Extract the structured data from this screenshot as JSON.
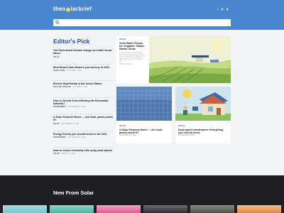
{
  "site": {
    "logo_parts": [
      "thes",
      "larbrief"
    ],
    "social_icons": [
      "facebook-icon",
      "twitter-icon",
      "twitter-bird-icon"
    ]
  },
  "search": {
    "placeholder": "",
    "value": ""
  },
  "editors_pick": {
    "title": "Editor's Pick",
    "items": [
      {
        "title": "Ten Facts about climate change you didn't know about",
        "category": "SOLAR",
        "date": ""
      },
      {
        "title": "Best Robot Lawn Mowers you can buy in 2020",
        "category": "SMART HOME",
        "date": "OCTOBER 2, 2020"
      },
      {
        "title": "Electric Boat Rental in the United States",
        "category": "ELECTRIC VEHICLES",
        "date": "OCTOBER 1, 2020"
      },
      {
        "title": "How is Corona Virus Affecting the Renewable Industry?",
        "category": "ENVIRONMENT",
        "date": "SEPTEMBER 30, 2020"
      },
      {
        "title": "A Solar-Powered Home — Are solar panels worth it?",
        "category": "SOLAR",
        "date": "SEPTEMBER 29, 2020"
      },
      {
        "title": "Energy Stocks you should invest in for 2021",
        "category": "ENVIRONMENT",
        "date": "SEPTEMBER 28, 2020"
      },
      {
        "title": "How to reduce electricity bills using solar panels",
        "category": "SOLAR",
        "date": "MARCH 12, 2020"
      }
    ]
  },
  "featured": {
    "category": "SOLAR",
    "title": "Solar Water Pumps for Irrigation: Simple Starter Guide",
    "excerpt": "This article is for those already farmed and looking to spend less on their irrigation bills. This list of solar water pumps for irrigation use...",
    "date": "MARCH 12, 2020"
  },
  "card_panels": {
    "category": "SOLAR",
    "title": "A Solar-Powered Home — Are solar panels worth it?",
    "date": "SEPTEMBER 29, 2020"
  },
  "card_maintenance": {
    "category": "SOLAR",
    "title": "Solar panel maintenance: Everything you need to know",
    "date": "SEPTEMBER 28, 2020"
  },
  "new_from_solar": {
    "title": "New From Solar"
  },
  "colors": {
    "header_blue": "#4a87d0",
    "title_blue": "#1f4fa0",
    "dark_band": "#1f1e20"
  }
}
